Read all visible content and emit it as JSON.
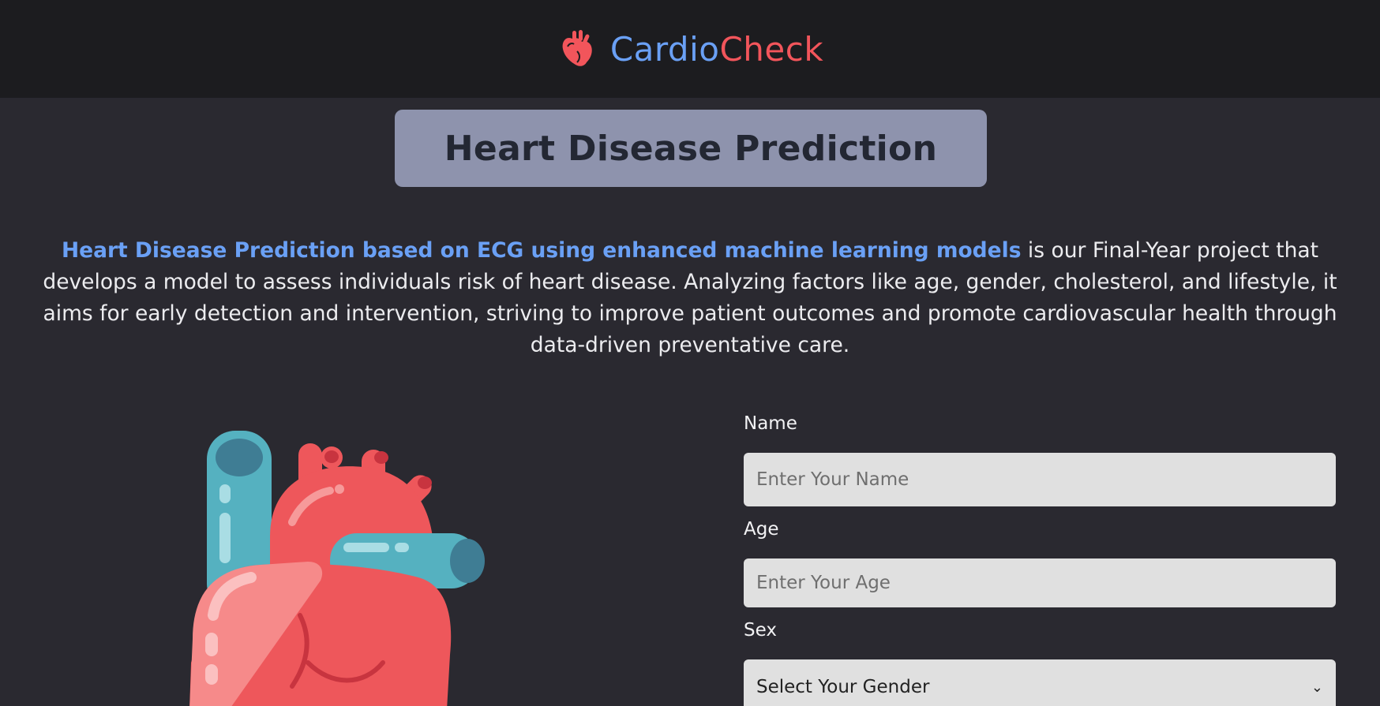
{
  "brand": {
    "part1": "Cardio",
    "part2": "Check",
    "icon": "heart-organ-icon"
  },
  "title": "Heart Disease Prediction",
  "intro": {
    "highlight": "Heart Disease Prediction based on ECG using enhanced machine learning models",
    "body": " is our Final-Year project that develops a model to assess individuals risk of heart disease. Analyzing factors like age, gender, cholesterol, and lifestyle, it aims for early detection and intervention, striving to improve patient outcomes and promote cardiovascular health through data-driven preventative care."
  },
  "illustration": {
    "icon": "heart-illustration"
  },
  "form": {
    "name": {
      "label": "Name",
      "placeholder": "Enter Your Name",
      "value": ""
    },
    "age": {
      "label": "Age",
      "placeholder": "Enter Your Age",
      "value": ""
    },
    "sex": {
      "label": "Sex",
      "selected": "Select Your Gender"
    }
  },
  "colors": {
    "accent_blue": "#6aa0f5",
    "accent_red": "#f2555b",
    "header_bg": "#1c1c1f",
    "page_bg": "#2a2930",
    "title_box_bg": "#8e93ad"
  }
}
